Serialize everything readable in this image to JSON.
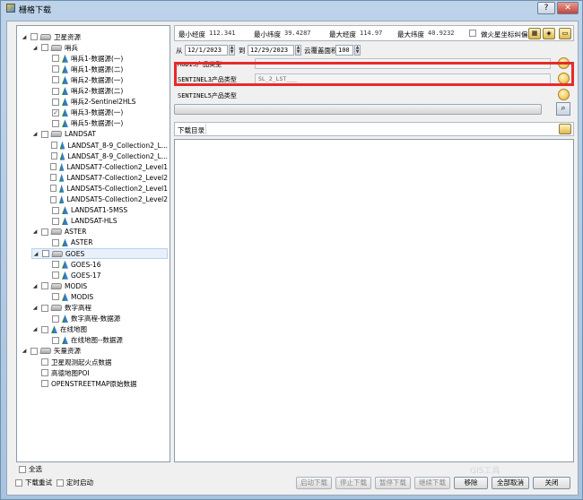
{
  "window": {
    "title": "栅格下载",
    "help_label": "?",
    "close_label": "✕"
  },
  "tree": [
    {
      "depth": 0,
      "expand": "◢",
      "check": "",
      "icon": "folder",
      "label": "卫星资源"
    },
    {
      "depth": 1,
      "expand": "◢",
      "check": "",
      "icon": "folder",
      "label": "哨兵"
    },
    {
      "depth": 2,
      "expand": "",
      "check": "",
      "icon": "leaf",
      "label": "哨兵1-数据源(一)"
    },
    {
      "depth": 2,
      "expand": "",
      "check": "",
      "icon": "leaf",
      "label": "哨兵1-数据源(二)"
    },
    {
      "depth": 2,
      "expand": "",
      "check": "",
      "icon": "leaf",
      "label": "哨兵2-数据源(一)"
    },
    {
      "depth": 2,
      "expand": "",
      "check": "",
      "icon": "leaf",
      "label": "哨兵2-数据源(二)"
    },
    {
      "depth": 2,
      "expand": "",
      "check": "",
      "icon": "leaf",
      "label": "哨兵2-Sentinel2HLS"
    },
    {
      "depth": 2,
      "expand": "",
      "check": "✓",
      "icon": "leaf",
      "label": "哨兵3-数据源(一)"
    },
    {
      "depth": 2,
      "expand": "",
      "check": "",
      "icon": "leaf",
      "label": "哨兵5-数据源(一)"
    },
    {
      "depth": 1,
      "expand": "◢",
      "check": "",
      "icon": "folder",
      "label": "LANDSAT"
    },
    {
      "depth": 2,
      "expand": "",
      "check": "",
      "icon": "leaf",
      "label": "LANDSAT_8-9_Collection2_L..."
    },
    {
      "depth": 2,
      "expand": "",
      "check": "",
      "icon": "leaf",
      "label": "LANDSAT_8-9_Collection2_L..."
    },
    {
      "depth": 2,
      "expand": "",
      "check": "",
      "icon": "leaf",
      "label": "LANDSAT7-Collection2_Level1"
    },
    {
      "depth": 2,
      "expand": "",
      "check": "",
      "icon": "leaf",
      "label": "LANDSAT7-Collection2_Level2"
    },
    {
      "depth": 2,
      "expand": "",
      "check": "",
      "icon": "leaf",
      "label": "LANDSAT5-Collection2_Level1"
    },
    {
      "depth": 2,
      "expand": "",
      "check": "",
      "icon": "leaf",
      "label": "LANDSAT5-Collection2_Level2"
    },
    {
      "depth": 2,
      "expand": "",
      "check": "",
      "icon": "leaf",
      "label": "LANDSAT1-5MSS"
    },
    {
      "depth": 2,
      "expand": "",
      "check": "",
      "icon": "leaf",
      "label": "LANDSAT-HLS"
    },
    {
      "depth": 1,
      "expand": "◢",
      "check": "",
      "icon": "folder",
      "label": "ASTER"
    },
    {
      "depth": 2,
      "expand": "",
      "check": "",
      "icon": "leaf",
      "label": "ASTER"
    },
    {
      "depth": 1,
      "expand": "◢",
      "check": "",
      "icon": "folder",
      "label": "GOES",
      "selected": true
    },
    {
      "depth": 2,
      "expand": "",
      "check": "",
      "icon": "leaf",
      "label": "GOES-16"
    },
    {
      "depth": 2,
      "expand": "",
      "check": "",
      "icon": "leaf",
      "label": "GOES-17"
    },
    {
      "depth": 1,
      "expand": "◢",
      "check": "",
      "icon": "folder",
      "label": "MODIS"
    },
    {
      "depth": 2,
      "expand": "",
      "check": "",
      "icon": "leaf",
      "label": "MODIS"
    },
    {
      "depth": 1,
      "expand": "◢",
      "check": "",
      "icon": "folder",
      "label": "数字高程"
    },
    {
      "depth": 2,
      "expand": "",
      "check": "",
      "icon": "leaf",
      "label": "数字高程-数据源"
    },
    {
      "depth": 1,
      "expand": "◢",
      "check": "",
      "icon": "leaf",
      "label": "在线地图"
    },
    {
      "depth": 2,
      "expand": "",
      "check": "",
      "icon": "leaf",
      "label": "在线地图--数据源"
    },
    {
      "depth": 0,
      "expand": "◢",
      "check": "",
      "icon": "folder",
      "label": "矢量资源"
    },
    {
      "depth": 1,
      "expand": "",
      "check": "",
      "icon": "none",
      "label": "卫星观测起火点数据"
    },
    {
      "depth": 1,
      "expand": "",
      "check": "",
      "icon": "none",
      "label": "高德地图POI"
    },
    {
      "depth": 1,
      "expand": "",
      "check": "",
      "icon": "none",
      "label": "OPENSTREETMAP原始数据"
    }
  ],
  "select_all_label": "全选",
  "bounds": {
    "min_lon_label": "最小经度",
    "min_lon": "112.341",
    "min_lat_label": "最小纬度",
    "min_lat": "39.4287",
    "max_lon_label": "最大经度",
    "max_lon": "114.97",
    "max_lat_label": "最大纬度",
    "max_lat": "40.9232",
    "fire_label": "做火星坐标纠偏"
  },
  "dates": {
    "from_label": "从",
    "from": "12/1/2023",
    "to_label": "到",
    "to": "12/29/2023",
    "cloud_label": "云覆盖面积",
    "cloud": "100"
  },
  "products": [
    {
      "label": "MODIS产品类型",
      "value": ""
    },
    {
      "label": "SENTINEL3产品类型",
      "value": "SL_2_LST___"
    },
    {
      "label": "SENTINEL5产品类型",
      "value": ""
    }
  ],
  "download_dir_label": "下载目录",
  "bottom": {
    "retry_label": "下载重试",
    "timer_label": "定时启动",
    "start": "启动下载",
    "stop": "停止下载",
    "pause": "暂停下载",
    "resume": "继续下载",
    "remove": "移除",
    "cancel_all": "全部取消",
    "close": "关闭"
  },
  "watermark": "GIS工具"
}
